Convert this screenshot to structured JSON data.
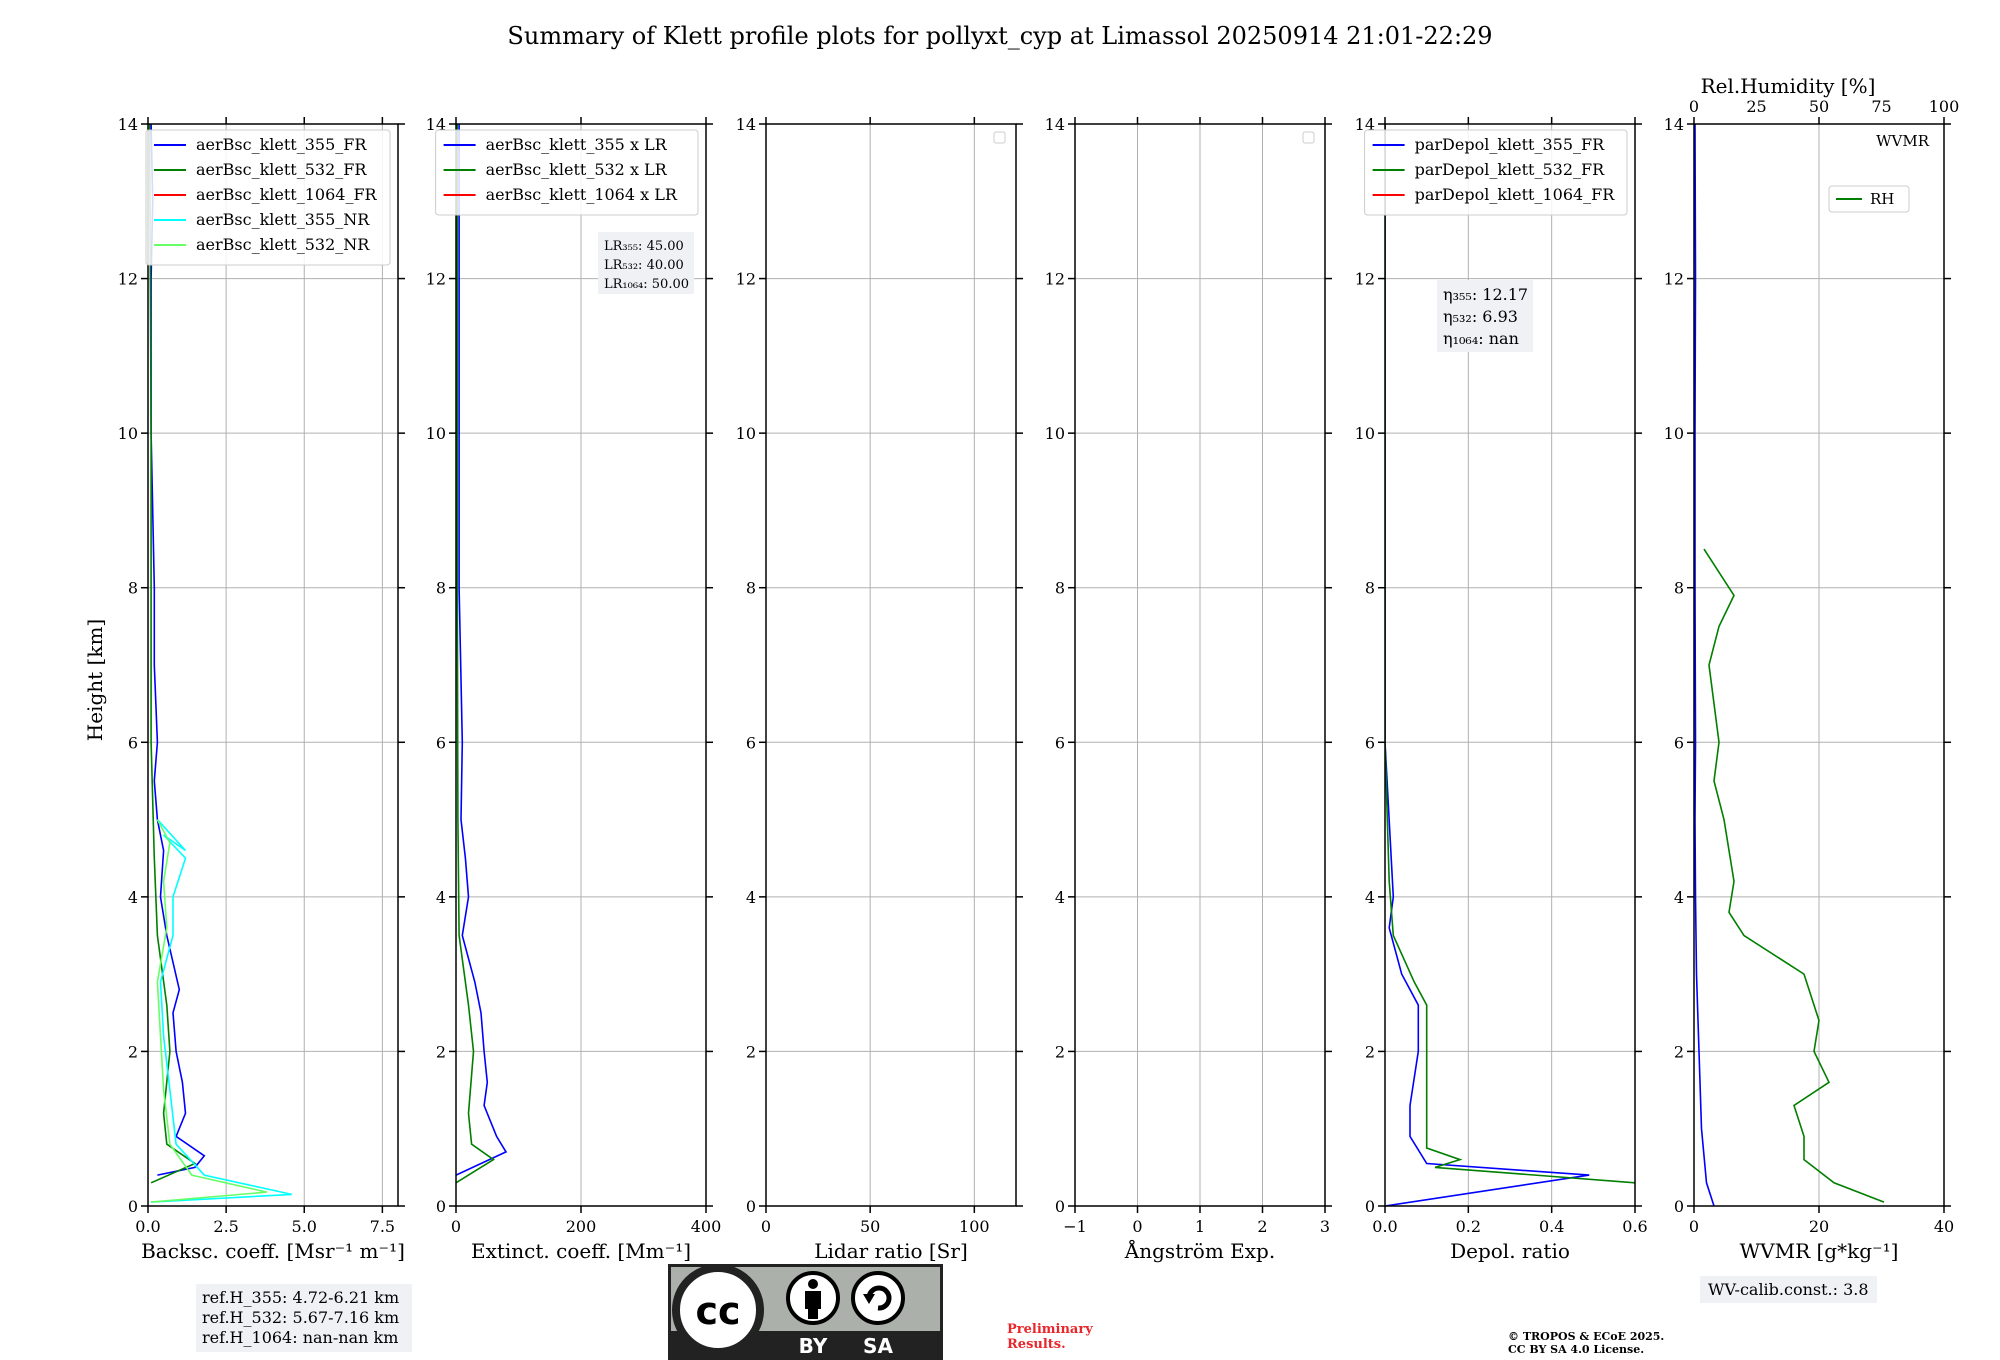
{
  "figure": {
    "title": "Summary of Klett profile plots for pollyxt_cyp at Limassol 20250914 21:01-22:29",
    "ylabel": "Height [km]"
  },
  "ref_heights": [
    "ref.H_355: 4.72-6.21 km",
    "ref.H_532: 5.67-7.16 km",
    "ref.H_1064: nan-nan km"
  ],
  "wv_calib": "WV-calib.const.: 3.8",
  "preliminary": [
    "Preliminary",
    "Results."
  ],
  "copyright": [
    "© TROPOS & ECoE 2025.",
    "CC BY SA 4.0 License."
  ],
  "license_badge": {
    "left": "BY",
    "right": "SA",
    "icons": [
      "cc-icon",
      "person-icon",
      "sharealike-icon"
    ]
  },
  "colors": {
    "c355": "#0000ff",
    "c532": "#007f00",
    "c1064": "#ff0000",
    "c355nr": "#00ffff",
    "c532nr": "#66ff66",
    "prelim": "#e8262b"
  },
  "chart_data": [
    {
      "type": "line",
      "xlabel": "Backsc. coeff. [Msr⁻¹ m⁻¹]",
      "ylabel": "Height [km]",
      "xlim": [
        0,
        8
      ],
      "ylim": [
        0,
        14
      ],
      "xticks": [
        "0.0",
        "2.5",
        "5.0",
        "7.5"
      ],
      "yticks": [
        "0",
        "2",
        "4",
        "6",
        "8",
        "10",
        "12",
        "14"
      ],
      "legend_loc": "upper-right",
      "legend": [
        "aerBsc_klett_355_FR",
        "aerBsc_klett_532_FR",
        "aerBsc_klett_1064_FR",
        "aerBsc_klett_355_NR",
        "aerBsc_klett_532_NR"
      ],
      "series": [
        {
          "name": "aerBsc_klett_355_FR",
          "color": "#0000ff",
          "x": [
            0.3,
            1.5,
            1.8,
            0.9,
            1.2,
            1.1,
            0.9,
            0.8,
            1.0,
            0.6,
            0.4,
            0.5,
            0.3,
            0.2,
            0.3,
            0.2,
            0.2,
            0.15,
            0.1,
            0.1,
            0.1,
            0.15,
            0.1
          ],
          "y": [
            0.4,
            0.5,
            0.65,
            0.9,
            1.2,
            1.6,
            2.0,
            2.5,
            2.8,
            3.5,
            4.0,
            4.6,
            5.0,
            5.5,
            6.0,
            7.0,
            8.0,
            9.0,
            10.0,
            11.0,
            12.0,
            13.0,
            14.0
          ]
        },
        {
          "name": "aerBsc_klett_532_FR",
          "color": "#007f00",
          "x": [
            0.1,
            1.5,
            0.6,
            0.5,
            0.7,
            0.6,
            0.3,
            0.2,
            0.1,
            0.1,
            0.1,
            0.05
          ],
          "y": [
            0.3,
            0.55,
            0.8,
            1.2,
            2.0,
            2.6,
            3.5,
            4.5,
            6.0,
            8.0,
            10.0,
            14.0
          ]
        },
        {
          "name": "aerBsc_klett_355_NR",
          "color": "#00ffff",
          "x": [
            0.1,
            4.6,
            1.8,
            0.9,
            0.7,
            0.5,
            0.4,
            0.8,
            0.8,
            1.2,
            0.5,
            1.2,
            0.3
          ],
          "y": [
            0.05,
            0.15,
            0.4,
            0.8,
            1.5,
            2.2,
            2.9,
            3.5,
            4.0,
            4.5,
            4.8,
            4.6,
            5.0
          ]
        },
        {
          "name": "aerBsc_klett_532_NR",
          "color": "#66ff66",
          "x": [
            0.1,
            3.8,
            1.4,
            0.7,
            0.5,
            0.4,
            0.3,
            0.6,
            0.5,
            0.7,
            0.3
          ],
          "y": [
            0.05,
            0.18,
            0.4,
            0.8,
            1.5,
            2.2,
            2.9,
            3.6,
            4.2,
            4.7,
            5.0
          ]
        }
      ]
    },
    {
      "type": "line",
      "xlabel": "Extinct. coeff. [Mm⁻¹]",
      "xlim": [
        0,
        400
      ],
      "ylim": [
        0,
        14
      ],
      "xticks": [
        "0",
        "200",
        "400"
      ],
      "yticks": [
        "0",
        "2",
        "4",
        "6",
        "8",
        "10",
        "12",
        "14"
      ],
      "legend_loc": "upper-right",
      "legend": [
        "aerBsc_klett_355 x LR",
        "aerBsc_klett_532 x LR",
        "aerBsc_klett_1064 x LR"
      ],
      "lidar_ratios": [
        "LR₃₅₅: 45.00",
        "LR₅₃₂: 40.00",
        "LR₁₀₆₄: 50.00"
      ],
      "series": [
        {
          "name": "aerBsc_klett_355 x LR",
          "color": "#0000ff",
          "x": [
            0,
            80,
            65,
            45,
            50,
            45,
            40,
            30,
            10,
            20,
            15,
            8,
            10,
            5,
            5,
            5,
            5
          ],
          "y": [
            0.4,
            0.7,
            0.9,
            1.3,
            1.6,
            2.0,
            2.5,
            2.9,
            3.5,
            4.0,
            4.5,
            5.0,
            6.0,
            8.0,
            10.0,
            12.0,
            14.0
          ]
        },
        {
          "name": "aerBsc_klett_532 x LR",
          "color": "#007f00",
          "x": [
            0,
            60,
            25,
            20,
            28,
            20,
            5,
            3,
            2,
            2
          ],
          "y": [
            0.3,
            0.6,
            0.8,
            1.2,
            2.0,
            2.6,
            3.5,
            5.0,
            8.0,
            14.0
          ]
        }
      ]
    },
    {
      "type": "line",
      "xlabel": "Lidar ratio [Sr]",
      "xlim": [
        0,
        120
      ],
      "ylim": [
        0,
        14
      ],
      "xticks": [
        "0",
        "50",
        "100"
      ],
      "yticks": [
        "0",
        "2",
        "4",
        "6",
        "8",
        "10",
        "12",
        "14"
      ],
      "series": []
    },
    {
      "type": "line",
      "xlabel": "Ångström Exp.",
      "xlim": [
        -1,
        3
      ],
      "ylim": [
        0,
        14
      ],
      "xticks": [
        "−1",
        "0",
        "1",
        "2",
        "3"
      ],
      "yticks": [
        "0",
        "2",
        "4",
        "6",
        "8",
        "10",
        "12",
        "14"
      ],
      "series": []
    },
    {
      "type": "line",
      "xlabel": "Depol. ratio",
      "xlim": [
        0,
        0.6
      ],
      "ylim": [
        0,
        14
      ],
      "xticks": [
        "0.0",
        "0.2",
        "0.4",
        "0.6"
      ],
      "yticks": [
        "0",
        "2",
        "4",
        "6",
        "8",
        "10",
        "12",
        "14"
      ],
      "legend_loc": "upper-right",
      "legend": [
        "parDepol_klett_355_FR",
        "parDepol_klett_532_FR",
        "parDepol_klett_1064_FR"
      ],
      "eta": [
        "η₃₅₅: 12.17",
        "η₅₃₂: 6.93",
        "η₁₀₆₄: nan"
      ],
      "series": [
        {
          "name": "parDepol_klett_355_FR",
          "color": "#0000ff",
          "x": [
            0.0,
            0.49,
            0.1,
            0.06,
            0.06,
            0.08,
            0.08,
            0.04,
            0.01,
            0.02,
            0.0,
            0.0,
            0.0
          ],
          "y": [
            0.0,
            0.4,
            0.55,
            0.9,
            1.3,
            2.0,
            2.6,
            3.0,
            3.6,
            4.0,
            6.0,
            10.0,
            14.0
          ]
        },
        {
          "name": "parDepol_klett_532_FR",
          "color": "#007f00",
          "x": [
            0.6,
            0.12,
            0.18,
            0.1,
            0.1,
            0.1,
            0.1,
            0.07,
            0.02,
            0.01,
            0.0,
            0.0
          ],
          "y": [
            0.3,
            0.5,
            0.6,
            0.75,
            1.2,
            2.0,
            2.6,
            2.9,
            3.5,
            4.2,
            6.0,
            14.0
          ]
        }
      ]
    },
    {
      "type": "line",
      "xlabel": "WVMR [g*kg⁻¹]",
      "x2label": "Rel.Humidity [%]",
      "xlim": [
        0,
        50
      ],
      "x2lim": [
        0,
        100
      ],
      "ylim": [
        0,
        14
      ],
      "xticks": [
        "0",
        "20",
        "40"
      ],
      "x2ticks": [
        "0",
        "25",
        "50",
        "75",
        "100"
      ],
      "yticks": [
        "0",
        "2",
        "4",
        "6",
        "8",
        "10",
        "12",
        "14"
      ],
      "legend": [
        "WVMR",
        "RH"
      ],
      "series": [
        {
          "name": "WVMR",
          "color": "#0000ff",
          "x": [
            4.0,
            2.5,
            1.5,
            1.0,
            0.5,
            0.3,
            0.2,
            0.3,
            0.2,
            0.2,
            0.3,
            0.2
          ],
          "y": [
            0.0,
            0.3,
            1.0,
            2.0,
            3.0,
            4.0,
            5.0,
            6.0,
            8.0,
            10.0,
            12.0,
            14.0
          ]
        },
        {
          "name": "RH",
          "color": "#007f00",
          "x": [
            38,
            28,
            22,
            22,
            20,
            27,
            24,
            25,
            22,
            10,
            7,
            8,
            6,
            4,
            5,
            4,
            3,
            5,
            8,
            2
          ],
          "y": [
            0.05,
            0.3,
            0.6,
            0.9,
            1.3,
            1.6,
            2.0,
            2.4,
            3.0,
            3.5,
            3.8,
            4.2,
            5.0,
            5.5,
            6.0,
            6.5,
            7.0,
            7.5,
            7.9,
            8.5
          ]
        }
      ]
    }
  ]
}
